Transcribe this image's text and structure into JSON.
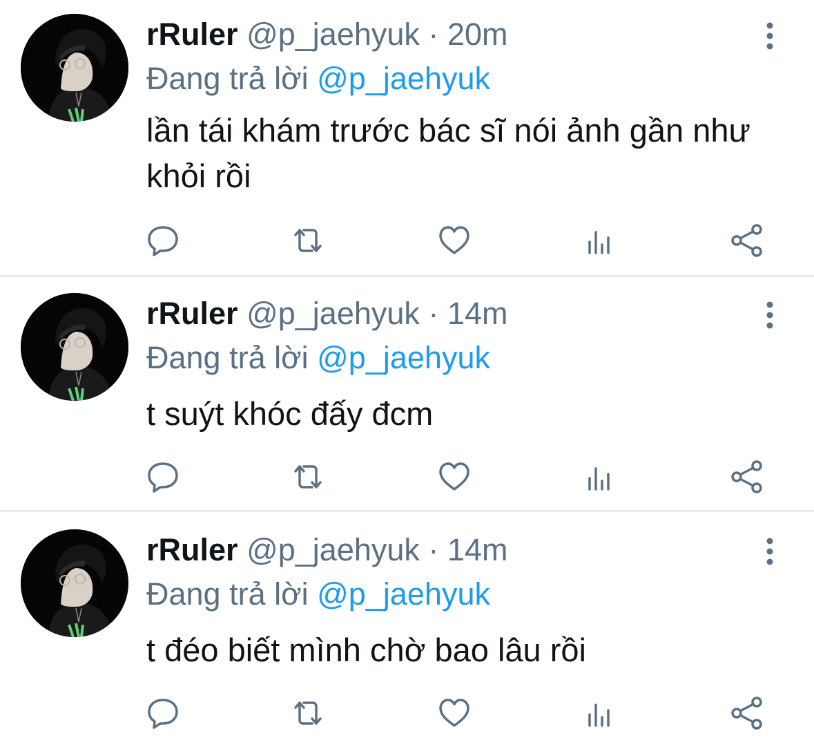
{
  "tweets": [
    {
      "name": "rRuler",
      "handle": "@p_jaehyuk",
      "separator": "·",
      "time": "20m",
      "reply_prefix": "Đang trả lời",
      "reply_to": "@p_jaehyuk",
      "text": "lần tái khám trước bác sĩ nói ảnh gần như khỏi rồi"
    },
    {
      "name": "rRuler",
      "handle": "@p_jaehyuk",
      "separator": "·",
      "time": "14m",
      "reply_prefix": "Đang trả lời",
      "reply_to": "@p_jaehyuk",
      "text": "t suýt khóc đấy đcm"
    },
    {
      "name": "rRuler",
      "handle": "@p_jaehyuk",
      "separator": "·",
      "time": "14m",
      "reply_prefix": "Đang trả lời",
      "reply_to": "@p_jaehyuk",
      "text": "t đéo biết mình chờ bao lâu rồi"
    }
  ],
  "icons": {
    "more": "more-vertical-icon",
    "reply": "reply-bubble-icon",
    "retweet": "retweet-icon",
    "like": "heart-icon",
    "analytics": "analytics-bars-icon",
    "share": "share-icon"
  },
  "colors": {
    "text": "#0f1419",
    "secondary": "#5b7083",
    "mention": "#1d9bf0",
    "divider": "#e9ecef"
  }
}
